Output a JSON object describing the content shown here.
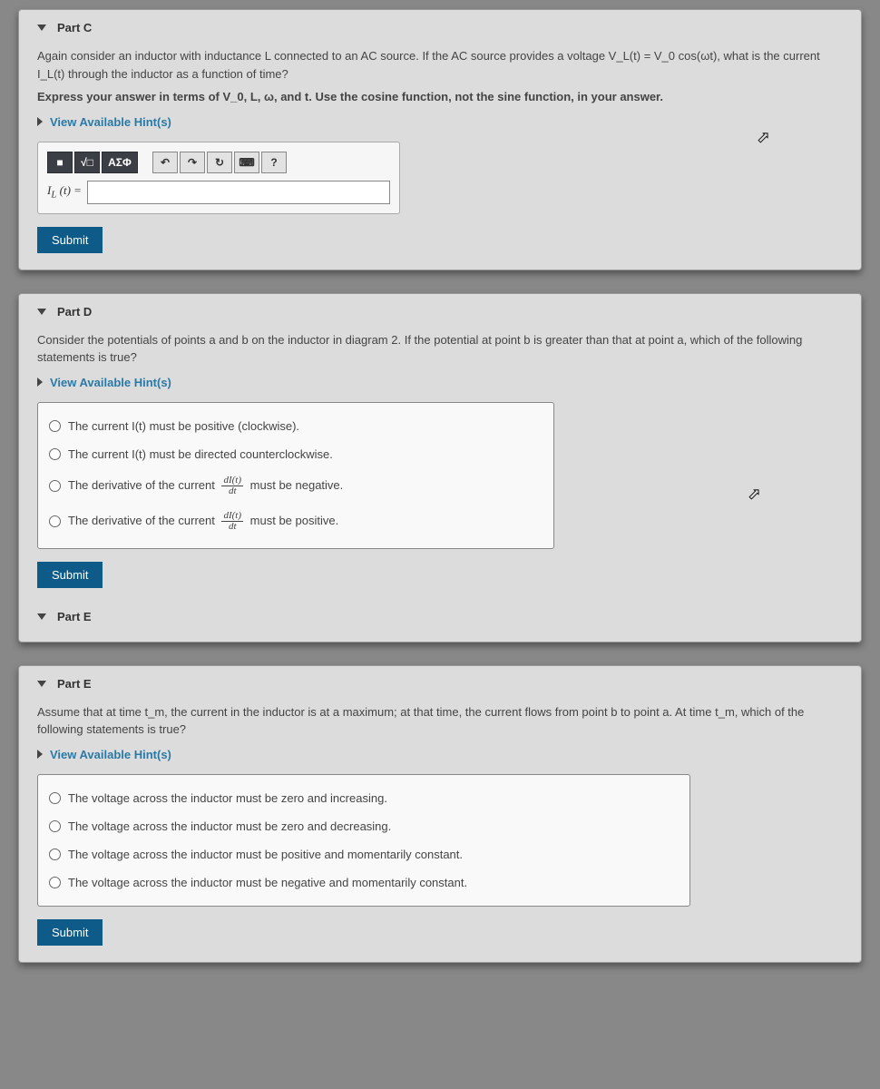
{
  "partC": {
    "title": "Part C",
    "prompt1": "Again consider an inductor with inductance L connected to an AC source. If the AC source provides a voltage V_L(t) = V_0 cos(ωt), what is the current I_L(t) through the inductor as a function of time?",
    "prompt2": "Express your answer in terms of V_0, L, ω, and t. Use the cosine function, not the sine function, in your answer.",
    "hint": "View Available Hint(s)",
    "toolbar": {
      "templates": "■",
      "sqrt": "√□",
      "greek": "ΑΣΦ",
      "undo": "↶",
      "redo": "↷",
      "reset": "↻",
      "keyboard": "⌨",
      "help": "?"
    },
    "inputLabel": "I_L (t) =",
    "submit": "Submit"
  },
  "partD": {
    "title": "Part D",
    "prompt": "Consider the potentials of points a and b on the inductor in diagram 2. If the potential at point b is greater than that at point a, which of the following statements is true?",
    "hint": "View Available Hint(s)",
    "options": {
      "o1": "The current I(t) must be positive (clockwise).",
      "o2": "The current I(t) must be directed counterclockwise.",
      "o3a": "The derivative of the current ",
      "o3b": " must be negative.",
      "o4a": "The derivative of the current ",
      "o4b": " must be positive.",
      "fracNum": "dI(t)",
      "fracDen": "dt"
    },
    "submit": "Submit"
  },
  "partE_stub": {
    "title": "Part E"
  },
  "partE": {
    "title": "Part E",
    "prompt": "Assume that at time t_m, the current in the inductor is at a maximum; at that time, the current flows from point b to point a. At time t_m, which of the following statements is true?",
    "hint": "View Available Hint(s)",
    "options": {
      "o1": "The voltage across the inductor must be zero and increasing.",
      "o2": "The voltage across the inductor must be zero and decreasing.",
      "o3": "The voltage across the inductor must be positive and momentarily constant.",
      "o4": "The voltage across the inductor must be negative and momentarily constant."
    },
    "submit": "Submit"
  }
}
